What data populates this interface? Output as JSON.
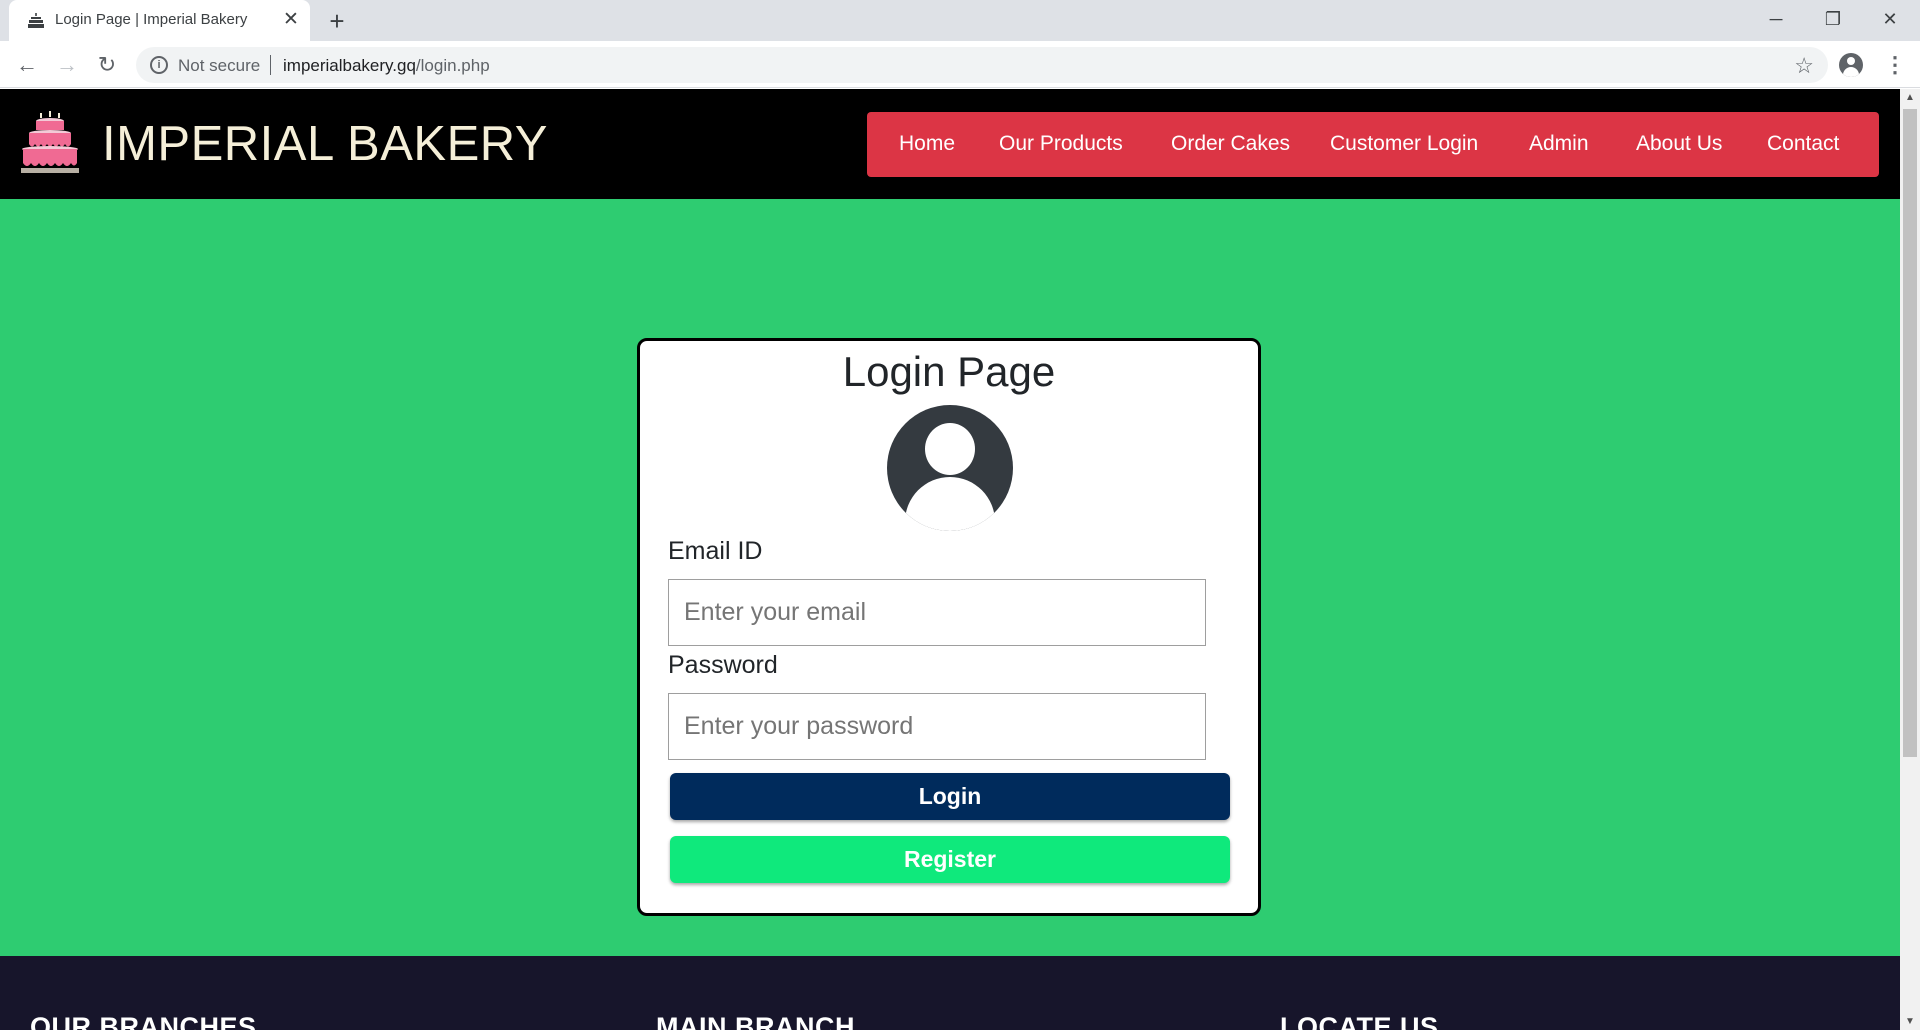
{
  "browser": {
    "tab_title": "Login Page | Imperial Bakery",
    "tab_close": "✕",
    "new_tab": "+",
    "security_label": "Not secure",
    "url_host": "imperialbakery.gq",
    "url_path": "/login.php",
    "window_controls": {
      "minimize": "─",
      "maximize": "❐",
      "close": "✕"
    },
    "nav": {
      "back": "←",
      "forward": "→",
      "reload": "↻"
    },
    "star": "☆",
    "menu": "⋮"
  },
  "site": {
    "brand": "IMPERIAL BAKERY",
    "nav_items": [
      "Home",
      "Our Products",
      "Order Cakes",
      "Customer Login",
      "Admin",
      "About Us",
      "Contact"
    ]
  },
  "login": {
    "title": "Login Page",
    "email_label": "Email ID",
    "email_placeholder": "Enter your email",
    "password_label": "Password",
    "password_placeholder": "Enter your password",
    "login_button": "Login",
    "register_button": "Register"
  },
  "footer": {
    "headings": [
      "OUR BRANCHES",
      "MAIN BRANCH",
      "LOCATE US"
    ]
  },
  "colors": {
    "header_bg": "#000000",
    "nav_bg": "#dc3545",
    "main_bg": "#2ecc71",
    "login_button": "#002b5c",
    "register_button": "#0fe97c",
    "footer_bg": "#17152b"
  },
  "icons": {
    "tab_favicon": "cake-icon",
    "logo": "cake-icon",
    "avatar": "user-circle-icon",
    "profile": "account-icon"
  }
}
